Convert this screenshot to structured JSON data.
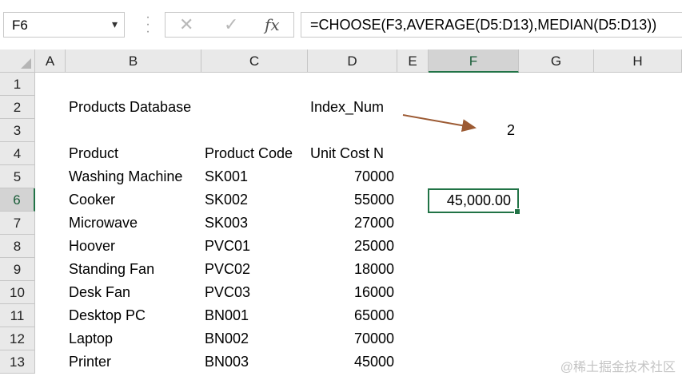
{
  "name_box": {
    "value": "F6"
  },
  "formula_bar": {
    "cancel_icon": "✕",
    "enter_icon": "✓",
    "fx_label": "fx",
    "formula": "=CHOOSE(F3,AVERAGE(D5:D13),MEDIAN(D5:D13))"
  },
  "columns": [
    "A",
    "B",
    "C",
    "D",
    "E",
    "F",
    "G",
    "H"
  ],
  "rows": [
    "1",
    "2",
    "3",
    "4",
    "5",
    "6",
    "7",
    "8",
    "9",
    "10",
    "11",
    "12",
    "13"
  ],
  "selected": {
    "column": "F",
    "row": "6"
  },
  "sheet": {
    "title": "Products Database",
    "index_label": "Index_Num",
    "index_value": "2",
    "headers": {
      "product": "Product",
      "code": "Product Code",
      "cost": "Unit Cost N"
    },
    "items": [
      {
        "product": "Washing Machine",
        "code": "SK001",
        "cost": "70000"
      },
      {
        "product": "Cooker",
        "code": "SK002",
        "cost": "55000"
      },
      {
        "product": "Microwave",
        "code": "SK003",
        "cost": "27000"
      },
      {
        "product": "Hoover",
        "code": "PVC01",
        "cost": "25000"
      },
      {
        "product": "Standing Fan",
        "code": "PVC02",
        "cost": "18000"
      },
      {
        "product": "Desk Fan",
        "code": "PVC03",
        "cost": "16000"
      },
      {
        "product": "Desktop PC",
        "code": "BN001",
        "cost": "65000"
      },
      {
        "product": "Laptop",
        "code": "BN002",
        "cost": "70000"
      },
      {
        "product": "Printer",
        "code": "BN003",
        "cost": "45000"
      }
    ],
    "result": "45,000.00"
  },
  "colors": {
    "arrow": "#9c5a33",
    "selection": "#217346"
  },
  "watermark": "@稀土掘金技术社区"
}
